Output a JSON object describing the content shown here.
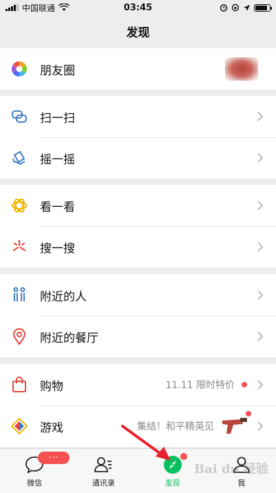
{
  "status_bar": {
    "carrier": "中国联通",
    "time": "03:45"
  },
  "nav": {
    "title": "发现"
  },
  "groups": [
    {
      "items": [
        {
          "label": "朋友圈",
          "icon": "moments-icon"
        }
      ]
    },
    {
      "items": [
        {
          "label": "扫一扫",
          "icon": "scan-icon"
        },
        {
          "label": "摇一摇",
          "icon": "shake-icon"
        }
      ]
    },
    {
      "items": [
        {
          "label": "看一看",
          "icon": "top-stories-icon"
        },
        {
          "label": "搜一搜",
          "icon": "search-icon"
        }
      ]
    },
    {
      "items": [
        {
          "label": "附近的人",
          "icon": "people-nearby-icon"
        },
        {
          "label": "附近的餐厅",
          "icon": "location-pin-icon"
        }
      ]
    },
    {
      "items": [
        {
          "label": "购物",
          "icon": "shopping-bag-icon",
          "extra": "11.11 限时特价"
        },
        {
          "label": "游戏",
          "icon": "games-icon",
          "extra": "集结！和平精英见"
        }
      ]
    }
  ],
  "tab_bar": {
    "tabs": [
      {
        "label": "微信",
        "icon": "chat-icon",
        "badge": "···"
      },
      {
        "label": "通讯录",
        "icon": "contacts-icon"
      },
      {
        "label": "发现",
        "icon": "compass-icon",
        "active": true
      },
      {
        "label": "我",
        "icon": "profile-icon"
      }
    ]
  },
  "watermark": "Bai du 经验",
  "colors": {
    "accent_green": "#07c160",
    "badge_red": "#f55151",
    "annotation_arrow": "#e8202a"
  }
}
